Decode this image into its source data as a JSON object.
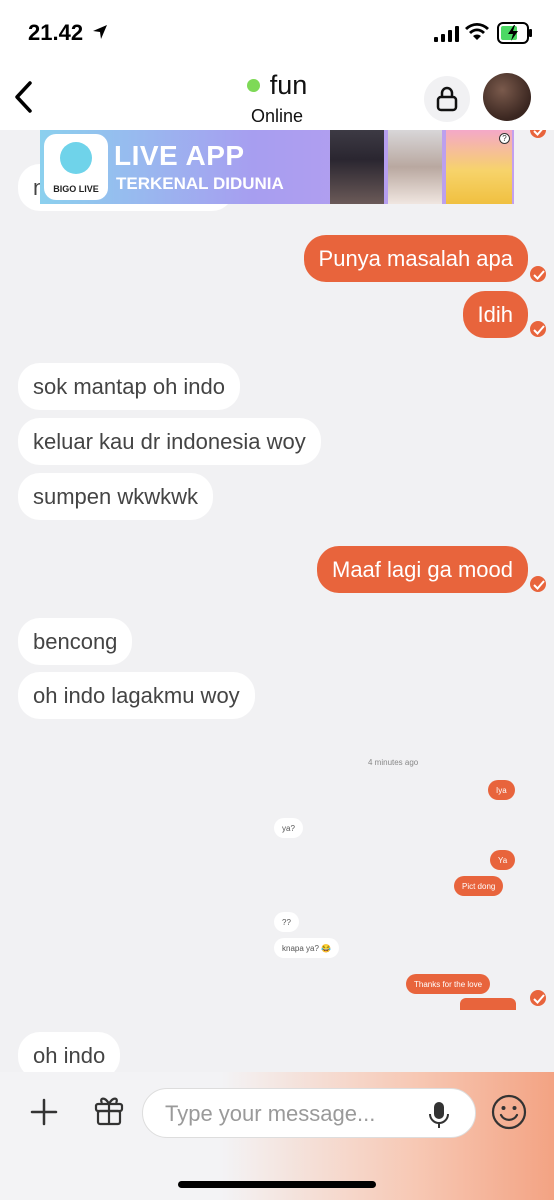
{
  "status_bar": {
    "time": "21.42"
  },
  "header": {
    "contact_name": "fun",
    "status": "Online"
  },
  "ad": {
    "logo_label": "BIGO LIVE",
    "line1": "LIVE APP",
    "line2": "TERKENAL DIDUNIA"
  },
  "messages": [
    {
      "dir": "in",
      "text": "n"
    },
    {
      "dir": "out",
      "text": "Punya masalah apa"
    },
    {
      "dir": "out",
      "text": "Idih"
    },
    {
      "dir": "in",
      "text": "sok mantap oh indo"
    },
    {
      "dir": "in",
      "text": "keluar kau dr indonesia woy"
    },
    {
      "dir": "in",
      "text": "sumpen wkwkwk"
    },
    {
      "dir": "out",
      "text": "Maaf lagi ga mood"
    },
    {
      "dir": "in",
      "text": "bencong"
    },
    {
      "dir": "in",
      "text": "oh indo lagakmu woy"
    },
    {
      "dir": "in",
      "text": "oh indo"
    }
  ],
  "embedded_screenshot": {
    "time_label": "4 minutes ago",
    "messages": [
      {
        "dir": "out",
        "text": "Iya"
      },
      {
        "dir": "in",
        "text": "ya?"
      },
      {
        "dir": "out",
        "text": "Ya"
      },
      {
        "dir": "out",
        "text": "Pict dong"
      },
      {
        "dir": "in",
        "text": "??"
      },
      {
        "dir": "in",
        "text": "knapa ya? 😂"
      },
      {
        "dir": "out",
        "text": "Thanks for the love"
      }
    ]
  },
  "input": {
    "placeholder": "Type your message..."
  },
  "colors": {
    "accent": "#e8643c",
    "online": "#7ed957",
    "background": "#f1f1f3"
  },
  "icons": [
    "location-arrow-icon",
    "signal-icon",
    "wifi-icon",
    "battery-icon",
    "back-chevron-icon",
    "lock-icon",
    "plus-icon",
    "gift-icon",
    "mic-icon",
    "emoji-icon",
    "check-icon"
  ]
}
